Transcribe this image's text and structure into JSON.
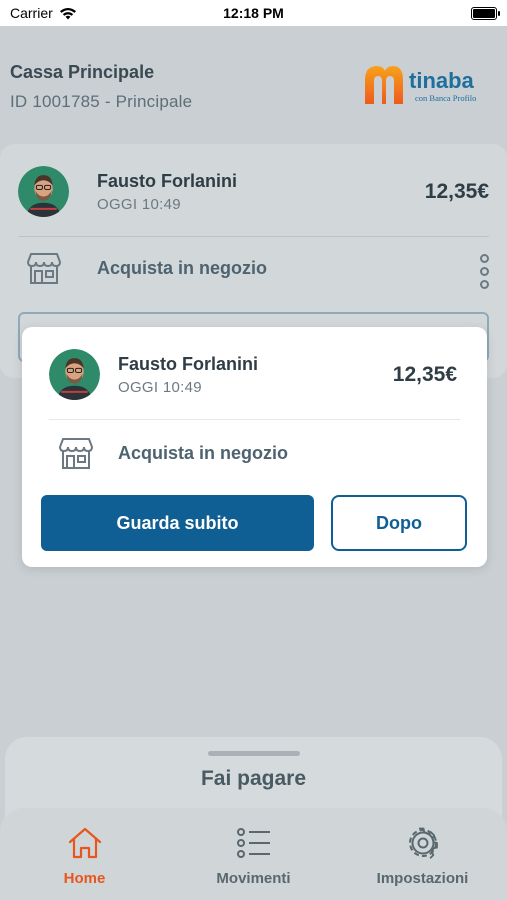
{
  "status_bar": {
    "carrier": "Carrier",
    "time": "12:18 PM"
  },
  "header": {
    "account_name": "Cassa Principale",
    "account_id": "ID 1001785  -  Principale",
    "logo": {
      "brand": "tinaba",
      "sub": "con Banca Profilo"
    }
  },
  "background_card": {
    "payer_name": "Fausto Forlanini",
    "payer_time": "OGGI 10:49",
    "amount": "12,35€",
    "description": "Acquista in negozio"
  },
  "modal": {
    "payer_name": "Fausto Forlanini",
    "payer_time": "OGGI 10:49",
    "amount": "12,35€",
    "description": "Acquista in negozio",
    "primary_button": "Guarda subito",
    "secondary_button": "Dopo"
  },
  "bottom_sheet": {
    "title": "Fai pagare"
  },
  "tabbar": {
    "items": [
      {
        "label": "Home",
        "icon": "home-icon",
        "active": true
      },
      {
        "label": "Movimenti",
        "icon": "list-icon",
        "active": false
      },
      {
        "label": "Impostazioni",
        "icon": "gear-icon",
        "active": false
      }
    ]
  },
  "colors": {
    "accent_orange": "#e8561e",
    "primary_blue": "#0f5f94",
    "overlay_bg": "#c9cfd3"
  }
}
